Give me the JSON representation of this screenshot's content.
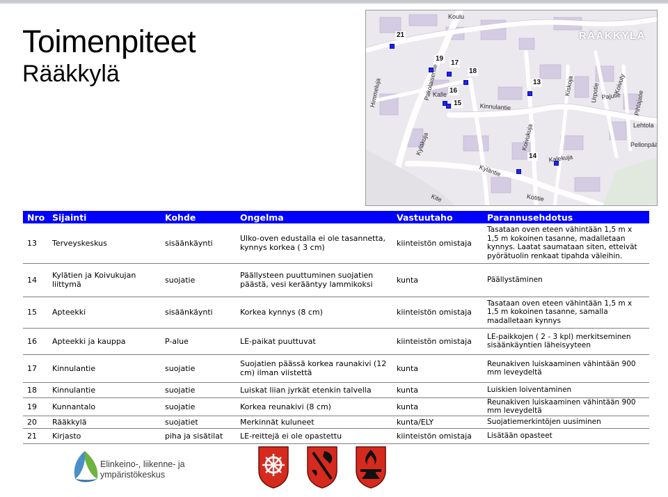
{
  "page": {
    "title": "Toimenpiteet",
    "subtitle": "Rääkkylä"
  },
  "map": {
    "region_label": "RÄÄKKYLÄ",
    "markers": [
      "21",
      "19",
      "17",
      "18",
      "13",
      "16",
      "15",
      "14"
    ],
    "street_labels": [
      "Koulu",
      "Pakolaisentie",
      "Kinnulantie",
      "Kyläntie",
      "Kotitie",
      "Kalekuja",
      "Koivukuja",
      "Kiskoja",
      "Urpotie",
      "Pajutie",
      "Pihlajatie",
      "Lehtola",
      "Pellonpää",
      "Kalle",
      "Kyläkuja",
      "Himmeluja",
      "Koivuty",
      "Kite"
    ],
    "colors": {
      "background": "#ebe8ee",
      "block": "#d9d2e6",
      "road": "#ffffff",
      "marker": "#1a22ff"
    }
  },
  "table": {
    "headers": [
      "Nro",
      "Sijainti",
      "Kohde",
      "Ongelma",
      "Vastuutaho",
      "Parannusehdotus"
    ],
    "rows": [
      {
        "nro": "13",
        "sijainti": "Terveyskeskus",
        "kohde": "sisäänkäynti",
        "ongelma": "Ulko-oven edustalla ei ole tasannetta, kynnys korkea ( 3 cm)",
        "vastuutaho": "kiinteistön omistaja",
        "parannus": "Tasataan oven eteen vähintään 1,5 m x 1,5 m kokoinen tasanne, madalletaan kynnys. Laatat saumataan siten, etteivät pyörätuolin renkaat tipahda väleihin."
      },
      {
        "nro": "14",
        "sijainti": "Kylätien ja Koivukujan liittymä",
        "kohde": "suojatie",
        "ongelma": "Päällysteen puuttuminen suojatien päästä, vesi kerääntyy lammikoksi",
        "vastuutaho": "kunta",
        "parannus": "Päällystäminen"
      },
      {
        "nro": "15",
        "sijainti": "Apteekki",
        "kohde": "sisäänkäynti",
        "ongelma": "Korkea kynnys (8 cm)",
        "vastuutaho": "kiinteistön omistaja",
        "parannus": "Tasataan oven eteen vähintään 1,5 m x 1,5 m kokoinen tasanne, samalla madalletaan kynnys"
      },
      {
        "nro": "16",
        "sijainti": "Apteekki ja kauppa",
        "kohde": "P-alue",
        "ongelma": "LE-paikat puuttuvat",
        "vastuutaho": "kiinteistön omistaja",
        "parannus": "LE-paikkojen ( 2 - 3 kpl) merkitseminen sisäänkäyntien läheisyyteen"
      },
      {
        "nro": "17",
        "sijainti": "Kinnulantie",
        "kohde": "suojatie",
        "ongelma": "Suojatien päässä korkea raunakivi (12 cm) ilman viistettä",
        "vastuutaho": "kunta",
        "parannus": "Reunakiven luiskaaminen vähintään 900 mm leveydeltä"
      },
      {
        "nro": "18",
        "sijainti": "Kinnulantie",
        "kohde": "suojatie",
        "ongelma": "Luiskat liian jyrkät etenkin talvella",
        "vastuutaho": "kunta",
        "parannus": "Luiskien loiventaminen"
      },
      {
        "nro": "19",
        "sijainti": "Kunnantalo",
        "kohde": "suojatie",
        "ongelma": "Korkea reunakivi (8 cm)",
        "vastuutaho": "kunta",
        "parannus": "Reunakiven luiskaaminen vähintään 900 mm leveydeltä"
      },
      {
        "nro": "20",
        "sijainti": "Rääkkylä",
        "kohde": "suojatiet",
        "ongelma": "Merkinnät kuluneet",
        "vastuutaho": "kunta/ELY",
        "parannus": "Suojatiemerkintöjen uusiminen"
      },
      {
        "nro": "21",
        "sijainti": "Kirjasto",
        "kohde": "piha ja sisätilat",
        "ongelma": "LE-reittejä ei ole opastettu",
        "vastuutaho": "kiinteistön omistaja",
        "parannus": "Lisätään opasteet"
      }
    ],
    "colors": {
      "header_bg": "#0000ff",
      "header_text": "#ffffff",
      "row_border": "#7f7f7f"
    }
  },
  "footer": {
    "logo_text_line1": "Elinkeino-, liikenne- ja",
    "logo_text_line2": "ympäristökeskus",
    "crests": [
      "rääkkylä-crest-ship-wheel",
      "crest-black-hatchet",
      "crest-anvil-flame"
    ]
  }
}
